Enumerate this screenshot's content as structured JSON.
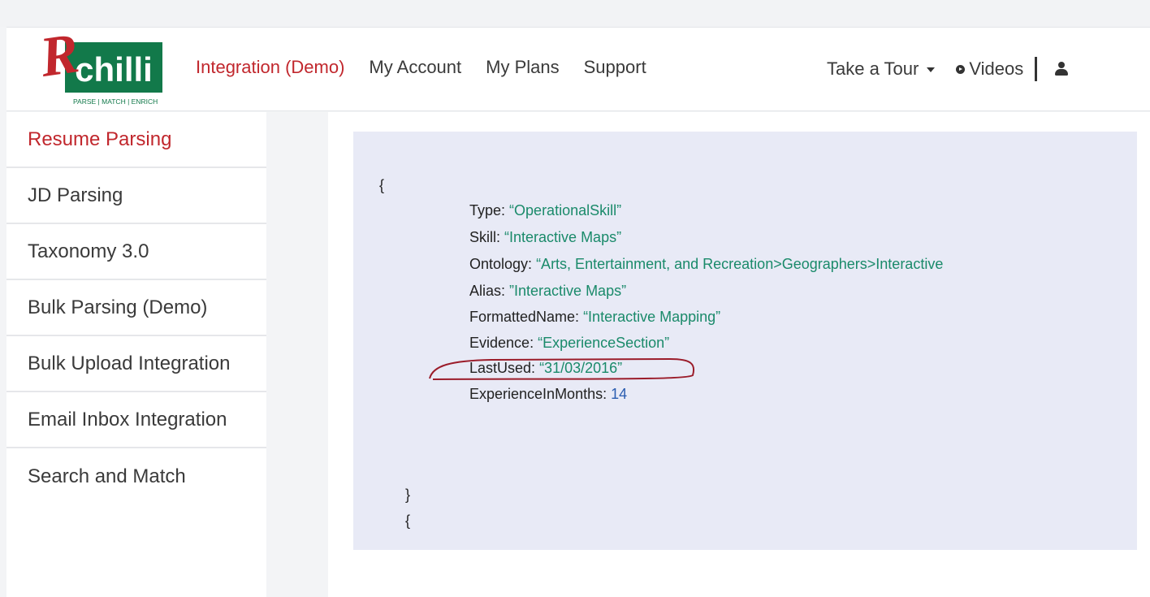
{
  "logo": {
    "letter": "R",
    "text": "chilli",
    "tagline": "PARSE | MATCH | ENRICH",
    "colors": {
      "red": "#c1272d",
      "green": "#12794a"
    }
  },
  "nav": {
    "items": [
      {
        "label": "Integration (Demo)",
        "active": true
      },
      {
        "label": "My Account"
      },
      {
        "label": "My Plans"
      },
      {
        "label": "Support"
      }
    ],
    "tour_label": "Take a Tour",
    "videos_label": "Videos"
  },
  "sidebar": {
    "items": [
      {
        "label": "Resume Parsing",
        "active": true
      },
      {
        "label": "JD Parsing"
      },
      {
        "label": "Taxonomy 3.0"
      },
      {
        "label": "Bulk Parsing (Demo)"
      },
      {
        "label": "Bulk Upload Integration"
      },
      {
        "label": "Email Inbox Integration"
      },
      {
        "label": "Search and Match"
      }
    ]
  },
  "code": {
    "open_brace": "{",
    "fields": [
      {
        "key": "Type",
        "value": "“OperationalSkill”"
      },
      {
        "key": "Skill",
        "value": "“Interactive Maps”"
      },
      {
        "key": "Ontology",
        "value": "“Arts, Entertainment, and Recreation>Geographers>Interactive"
      },
      {
        "key": "Alias",
        "value": "”Interactive Maps”"
      },
      {
        "key": "FormattedName",
        "value": "“Interactive Mapping”"
      },
      {
        "key": "Evidence",
        "value": "“ExperienceSection”"
      },
      {
        "key": "LastUsed",
        "value": "“31/03/2016”"
      },
      {
        "key": "ExperienceInMonths",
        "value": "14"
      }
    ],
    "close_brace": "}",
    "next_open_brace": "{"
  },
  "colors": {
    "accent": "#c1272d",
    "value": "#1a8a6a",
    "number": "#2a5db0",
    "panel": "#e8eaf6"
  }
}
